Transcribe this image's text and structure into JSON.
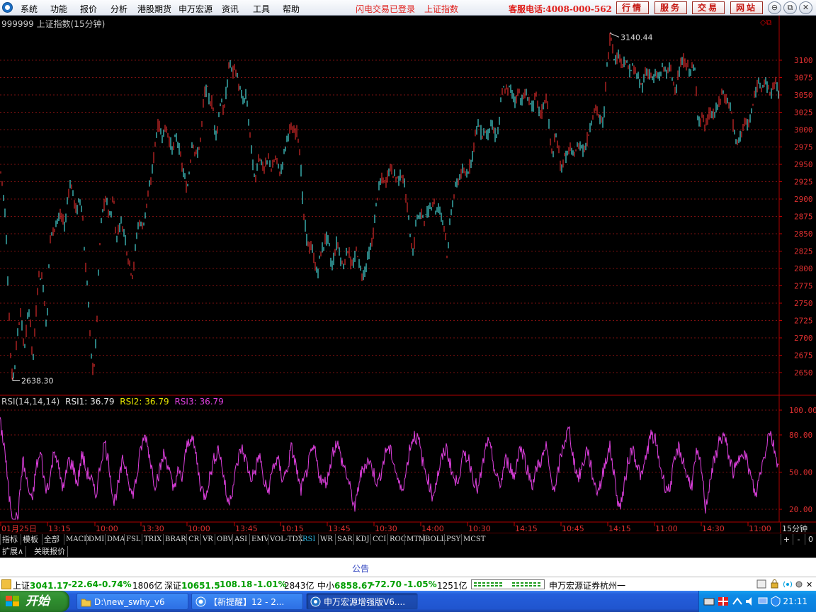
{
  "menu": [
    "系统",
    "功能",
    "报价",
    "分析",
    "港股期货",
    "申万宏源",
    "资讯",
    "工具",
    "帮助"
  ],
  "status_red": [
    "闪电交易已登录",
    "上证指数"
  ],
  "phone": "客服电话:4008-000-562",
  "top_buttons": [
    "行情",
    "服务",
    "交易",
    "网站"
  ],
  "window_buttons": [
    "⊖",
    "⧉",
    "✕"
  ],
  "chart_title": "999999 上证指数(15分钟)",
  "rsi": {
    "name": "RSI(14,14,14)",
    "rsi1": "RSI1: 36.79",
    "rsi2": "RSI2: 36.79",
    "rsi3": "RSI3: 36.79",
    "c1": "#e8e8e8",
    "c2": "#e6e600",
    "c3": "#e040e0"
  },
  "tabs1": [
    "指标",
    "模板",
    "全部",
    "MACD",
    "DMI",
    "DMA",
    "FSL",
    "TRIX",
    "BRAR",
    "CR",
    "VR",
    "OBV",
    "ASI",
    "EMV",
    "VOL-TDX",
    "RSI",
    "WR",
    "SAR",
    "KDJ",
    "CCI",
    "ROC",
    "MTM",
    "BOLL",
    "PSY",
    "MCST"
  ],
  "tabs1_active": "RSI",
  "zoom_buttons": [
    "+",
    "-",
    "0"
  ],
  "tabs2": [
    "扩展∧",
    "关联报价"
  ],
  "notice": "公告",
  "ticker": {
    "sh_label": "上证",
    "sh_val": "3041.17",
    "sh_chg": "-22.64",
    "sh_pct": "-0.74%",
    "sh_amt": "1806亿",
    "sz_label": "深证",
    "sz_val": "10651.5",
    "sz_chg": "-108.18",
    "sz_pct": "-1.01%",
    "sz_amt": "2843亿",
    "zx_label": "中小",
    "zx_val": "6858.67",
    "zx_chg": "-72.70",
    "zx_pct": "-1.05%",
    "zx_amt": "1251亿",
    "broker": "申万宏源证券杭州一"
  },
  "taskbar": {
    "start": "开始",
    "tasks": [
      "D:\\new_swhy_v6",
      "【新提醒】12 - 2...",
      "申万宏源增强版V6...."
    ],
    "clock": "21:11"
  },
  "chart_data": [
    {
      "type": "candlestick",
      "title": "999999 上证指数(15分钟)",
      "ylim": [
        2638.3,
        3140.44
      ],
      "y_ticks": [
        3100,
        3075,
        3050,
        3025,
        3000,
        2975,
        2950,
        2925,
        2900,
        2875,
        2850,
        2825,
        2800,
        2775,
        2750,
        2725,
        2700,
        2675,
        2650
      ],
      "annotations": [
        {
          "label": "3140.44",
          "type": "max"
        },
        {
          "label": "2638.30",
          "type": "min"
        }
      ],
      "x_labels": [
        "01月25日",
        "13:15",
        "10:00",
        "13:30",
        "10:00",
        "13:45",
        "10:15",
        "13:45",
        "10:30",
        "14:00",
        "10:30",
        "14:15",
        "10:45",
        "14:15",
        "11:00",
        "14:30",
        "11:00"
      ],
      "x_unit": "15分钟",
      "up_color": "#ff3232",
      "down_color": "#54ffff",
      "path": [
        [
          0,
          2945
        ],
        [
          3,
          2925
        ],
        [
          8,
          2870
        ],
        [
          12,
          2760
        ],
        [
          16,
          2645
        ],
        [
          20,
          2650
        ],
        [
          24,
          2700
        ],
        [
          29,
          2740
        ],
        [
          34,
          2680
        ],
        [
          38,
          2720
        ],
        [
          42,
          2745
        ],
        [
          46,
          2660
        ],
        [
          50,
          2720
        ],
        [
          54,
          2790
        ],
        [
          58,
          2790
        ],
        [
          62,
          2770
        ],
        [
          66,
          2705
        ],
        [
          70,
          2840
        ],
        [
          74,
          2850
        ],
        [
          80,
          2870
        ],
        [
          86,
          2875
        ],
        [
          92,
          2860
        ],
        [
          96,
          2910
        ],
        [
          100,
          2925
        ],
        [
          104,
          2900
        ],
        [
          108,
          2880
        ],
        [
          112,
          2900
        ],
        [
          116,
          2890
        ],
        [
          120,
          2810
        ],
        [
          124,
          2770
        ],
        [
          128,
          2680
        ],
        [
          132,
          2650
        ],
        [
          136,
          2700
        ],
        [
          140,
          2820
        ],
        [
          144,
          2880
        ],
        [
          150,
          2900
        ],
        [
          156,
          2870
        ],
        [
          160,
          2910
        ],
        [
          164,
          2840
        ],
        [
          170,
          2870
        ],
        [
          176,
          2850
        ],
        [
          180,
          2820
        ],
        [
          184,
          2800
        ],
        [
          188,
          2790
        ],
        [
          192,
          2840
        ],
        [
          196,
          2870
        ],
        [
          200,
          2860
        ],
        [
          204,
          2870
        ],
        [
          208,
          2900
        ],
        [
          212,
          2920
        ],
        [
          216,
          2950
        ],
        [
          220,
          2990
        ],
        [
          224,
          3010
        ],
        [
          228,
          2990
        ],
        [
          232,
          3000
        ],
        [
          236,
          3000
        ],
        [
          240,
          2980
        ],
        [
          244,
          2970
        ],
        [
          248,
          2990
        ],
        [
          252,
          2980
        ],
        [
          256,
          2950
        ],
        [
          260,
          2935
        ],
        [
          264,
          2910
        ],
        [
          268,
          2950
        ],
        [
          272,
          2990
        ],
        [
          276,
          2960
        ],
        [
          280,
          2970
        ],
        [
          284,
          2990
        ],
        [
          288,
          3050
        ],
        [
          292,
          3060
        ],
        [
          296,
          3040
        ],
        [
          300,
          3040
        ],
        [
          304,
          2990
        ],
        [
          308,
          3010
        ],
        [
          312,
          3050
        ],
        [
          316,
          3020
        ],
        [
          320,
          3060
        ],
        [
          324,
          3100
        ],
        [
          328,
          3080
        ],
        [
          332,
          3090
        ],
        [
          336,
          3070
        ],
        [
          340,
          3050
        ],
        [
          344,
          3040
        ],
        [
          348,
          3050
        ],
        [
          352,
          3000
        ],
        [
          356,
          2960
        ],
        [
          360,
          2920
        ],
        [
          364,
          2960
        ],
        [
          368,
          2960
        ],
        [
          372,
          2940
        ],
        [
          376,
          2950
        ],
        [
          380,
          2960
        ],
        [
          384,
          2940
        ],
        [
          388,
          2960
        ],
        [
          392,
          2950
        ],
        [
          396,
          2935
        ],
        [
          400,
          2960
        ],
        [
          404,
          2980
        ],
        [
          408,
          3000
        ],
        [
          412,
          3000
        ],
        [
          416,
          2995
        ],
        [
          420,
          3000
        ],
        [
          424,
          2960
        ],
        [
          428,
          2880
        ],
        [
          432,
          2850
        ],
        [
          436,
          2830
        ],
        [
          440,
          2830
        ],
        [
          444,
          2810
        ],
        [
          448,
          2790
        ],
        [
          452,
          2820
        ],
        [
          456,
          2830
        ],
        [
          460,
          2845
        ],
        [
          464,
          2840
        ],
        [
          468,
          2800
        ],
        [
          472,
          2820
        ],
        [
          476,
          2840
        ],
        [
          480,
          2820
        ],
        [
          484,
          2800
        ],
        [
          488,
          2820
        ],
        [
          492,
          2830
        ],
        [
          496,
          2800
        ],
        [
          500,
          2810
        ],
        [
          504,
          2830
        ],
        [
          508,
          2800
        ],
        [
          512,
          2790
        ],
        [
          516,
          2800
        ],
        [
          520,
          2820
        ],
        [
          524,
          2830
        ],
        [
          528,
          2860
        ],
        [
          532,
          2900
        ],
        [
          536,
          2920
        ],
        [
          540,
          2930
        ],
        [
          544,
          2920
        ],
        [
          548,
          2940
        ],
        [
          552,
          2945
        ],
        [
          556,
          2935
        ],
        [
          560,
          2930
        ],
        [
          564,
          2930
        ],
        [
          568,
          2940
        ],
        [
          572,
          2910
        ],
        [
          576,
          2880
        ],
        [
          580,
          2840
        ],
        [
          584,
          2820
        ],
        [
          588,
          2880
        ],
        [
          592,
          2870
        ],
        [
          596,
          2880
        ],
        [
          600,
          2870
        ],
        [
          604,
          2880
        ],
        [
          608,
          2890
        ],
        [
          612,
          2900
        ],
        [
          616,
          2880
        ],
        [
          620,
          2890
        ],
        [
          624,
          2870
        ],
        [
          628,
          2860
        ],
        [
          632,
          2810
        ],
        [
          636,
          2880
        ],
        [
          640,
          2900
        ],
        [
          644,
          2920
        ],
        [
          648,
          2930
        ],
        [
          652,
          2940
        ],
        [
          656,
          2935
        ],
        [
          660,
          2940
        ],
        [
          664,
          2950
        ],
        [
          668,
          2970
        ],
        [
          672,
          3000
        ],
        [
          676,
          3010
        ],
        [
          680,
          2990
        ],
        [
          684,
          3000
        ],
        [
          688,
          2990
        ],
        [
          692,
          3010
        ],
        [
          696,
          3000
        ],
        [
          700,
          2990
        ],
        [
          704,
          3000
        ],
        [
          708,
          3050
        ],
        [
          712,
          3060
        ],
        [
          716,
          3055
        ],
        [
          720,
          3060
        ],
        [
          724,
          3050
        ],
        [
          728,
          3040
        ],
        [
          732,
          3060
        ],
        [
          736,
          3040
        ],
        [
          740,
          3050
        ],
        [
          744,
          3050
        ],
        [
          748,
          3040
        ],
        [
          752,
          3030
        ],
        [
          756,
          3050
        ],
        [
          760,
          3030
        ],
        [
          764,
          3020
        ],
        [
          768,
          3040
        ],
        [
          772,
          3050
        ],
        [
          776,
          2990
        ],
        [
          780,
          2960
        ],
        [
          784,
          2990
        ],
        [
          788,
          2980
        ],
        [
          792,
          2940
        ],
        [
          796,
          2960
        ],
        [
          800,
          2960
        ],
        [
          804,
          2975
        ],
        [
          808,
          2960
        ],
        [
          812,
          2970
        ],
        [
          816,
          2975
        ],
        [
          820,
          2980
        ],
        [
          824,
          2970
        ],
        [
          828,
          2980
        ],
        [
          832,
          3000
        ],
        [
          836,
          3020
        ],
        [
          840,
          3030
        ],
        [
          844,
          3025
        ],
        [
          848,
          3010
        ],
        [
          852,
          3010
        ],
        [
          856,
          3080
        ],
        [
          860,
          3120
        ],
        [
          862,
          3140
        ],
        [
          866,
          3110
        ],
        [
          870,
          3100
        ],
        [
          874,
          3110
        ],
        [
          878,
          3095
        ],
        [
          882,
          3100
        ],
        [
          886,
          3090
        ],
        [
          890,
          3085
        ],
        [
          894,
          3090
        ],
        [
          898,
          3080
        ],
        [
          902,
          3070
        ],
        [
          906,
          3060
        ],
        [
          910,
          3080
        ],
        [
          914,
          3085
        ],
        [
          918,
          3080
        ],
        [
          922,
          3070
        ],
        [
          926,
          3080
        ],
        [
          930,
          3075
        ],
        [
          934,
          3085
        ],
        [
          938,
          3090
        ],
        [
          942,
          3080
        ],
        [
          946,
          3090
        ],
        [
          950,
          3070
        ],
        [
          954,
          3060
        ],
        [
          958,
          3080
        ],
        [
          962,
          3095
        ],
        [
          966,
          3100
        ],
        [
          970,
          3090
        ],
        [
          974,
          3085
        ],
        [
          978,
          3090
        ],
        [
          982,
          3080
        ],
        [
          984,
          3030
        ],
        [
          988,
          3010
        ],
        [
          992,
          3020
        ],
        [
          996,
          3000
        ],
        [
          1000,
          3020
        ],
        [
          1004,
          3025
        ],
        [
          1008,
          3020
        ],
        [
          1012,
          3030
        ],
        [
          1016,
          3040
        ],
        [
          1020,
          3055
        ],
        [
          1024,
          3045
        ],
        [
          1028,
          3040
        ],
        [
          1032,
          3030
        ],
        [
          1036,
          3000
        ],
        [
          1040,
          2975
        ],
        [
          1044,
          2990
        ],
        [
          1048,
          3000
        ],
        [
          1052,
          3010
        ],
        [
          1056,
          3005
        ],
        [
          1060,
          3020
        ],
        [
          1064,
          3040
        ],
        [
          1068,
          3060
        ],
        [
          1072,
          3070
        ],
        [
          1076,
          3065
        ],
        [
          1080,
          3070
        ],
        [
          1084,
          3060
        ],
        [
          1088,
          3050
        ],
        [
          1092,
          3065
        ],
        [
          1096,
          3070
        ],
        [
          1100,
          3040
        ]
      ]
    },
    {
      "type": "line",
      "title": "RSI(14,14,14)",
      "ylim": [
        0,
        100
      ],
      "y_ticks": [
        100.0,
        80.0,
        50.0,
        20.0
      ],
      "color": "#e040e0",
      "series": [
        {
          "name": "RSI3",
          "values": [
            90,
            70,
            30,
            10,
            15,
            60,
            40,
            25,
            55,
            65,
            35,
            45,
            70,
            50,
            35,
            60,
            55,
            40,
            65,
            50,
            45,
            30,
            55,
            75,
            55,
            25,
            40,
            60,
            50,
            30,
            45,
            70,
            80,
            60,
            40,
            50,
            65,
            55,
            35,
            50,
            45,
            70,
            80,
            65,
            40,
            30,
            45,
            60,
            70,
            50,
            25,
            35,
            55,
            70,
            60,
            45,
            50,
            65,
            40,
            35,
            55,
            60,
            45,
            50,
            70,
            55,
            35,
            45,
            60,
            70,
            50,
            40,
            45,
            65,
            75,
            60,
            50,
            35,
            20,
            45,
            55,
            60,
            50,
            40,
            55,
            70,
            65,
            50,
            35,
            45,
            70,
            80,
            75,
            55,
            45,
            30,
            45,
            60,
            70,
            55,
            40,
            50,
            65,
            60,
            45,
            35,
            55,
            75,
            65,
            45,
            40,
            60,
            55,
            45,
            70,
            65,
            50,
            40,
            55,
            60,
            70,
            45,
            35,
            60,
            75,
            85,
            60,
            45,
            55,
            70,
            50,
            35,
            40,
            60,
            70,
            45,
            20,
            35,
            60,
            70,
            55,
            45,
            65,
            80,
            75,
            55,
            40,
            35,
            55,
            70,
            60,
            45,
            40,
            65,
            55,
            20,
            45,
            60,
            75,
            80,
            65,
            50,
            55,
            70,
            60,
            45,
            30,
            50,
            65,
            85,
            70,
            55
          ]
        }
      ]
    }
  ]
}
